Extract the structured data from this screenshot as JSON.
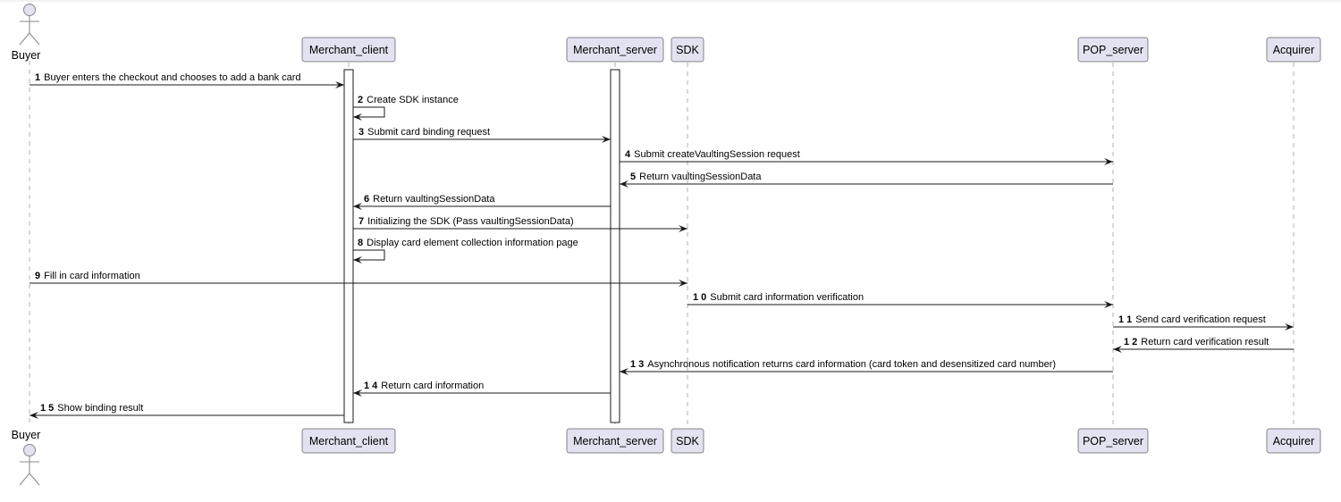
{
  "colors": {
    "participant_fill": "#e2e2f0",
    "participant_border": "#181818",
    "line": "#181818",
    "lifeline": "#b0b0b0"
  },
  "participants": [
    {
      "id": "buyer",
      "label": "Buyer",
      "kind": "actor"
    },
    {
      "id": "merchant_client",
      "label": "Merchant_client",
      "kind": "participant"
    },
    {
      "id": "merchant_server",
      "label": "Merchant_server",
      "kind": "participant"
    },
    {
      "id": "sdk",
      "label": "SDK",
      "kind": "participant"
    },
    {
      "id": "pop_server",
      "label": "POP_server",
      "kind": "participant"
    },
    {
      "id": "acquirer",
      "label": "Acquirer",
      "kind": "participant"
    }
  ],
  "messages": [
    {
      "num": "1",
      "from": "buyer",
      "to": "merchant_client",
      "text": "Buyer enters the checkout and chooses to add a bank card"
    },
    {
      "num": "2",
      "from": "merchant_client",
      "to": "merchant_client",
      "text": "Create SDK instance"
    },
    {
      "num": "3",
      "from": "merchant_client",
      "to": "merchant_server",
      "text": "Submit card binding request"
    },
    {
      "num": "4",
      "from": "merchant_server",
      "to": "pop_server",
      "text": "Submit createVaultingSession request"
    },
    {
      "num": "5",
      "from": "pop_server",
      "to": "merchant_server",
      "text": "Return vaultingSessionData"
    },
    {
      "num": "6",
      "from": "merchant_server",
      "to": "merchant_client",
      "text": "Return vaultingSessionData"
    },
    {
      "num": "7",
      "from": "merchant_client",
      "to": "sdk",
      "text": "Initializing the SDK (Pass vaultingSessionData)"
    },
    {
      "num": "8",
      "from": "merchant_client",
      "to": "merchant_client",
      "text": "Display card element collection information page"
    },
    {
      "num": "9",
      "from": "buyer",
      "to": "sdk",
      "text": "Fill in card information"
    },
    {
      "num": "1 0",
      "from": "sdk",
      "to": "pop_server",
      "text": "Submit card information verification"
    },
    {
      "num": "1 1",
      "from": "pop_server",
      "to": "acquirer",
      "text": "Send card verification request"
    },
    {
      "num": "1 2",
      "from": "acquirer",
      "to": "pop_server",
      "text": "Return card verification result"
    },
    {
      "num": "1 3",
      "from": "pop_server",
      "to": "merchant_server",
      "text": "Asynchronous notification returns card information (card token and desensitized card number)"
    },
    {
      "num": "1 4",
      "from": "merchant_server",
      "to": "merchant_client",
      "text": "Return card information"
    },
    {
      "num": "1 5",
      "from": "merchant_client",
      "to": "buyer",
      "text": "Show binding result"
    }
  ],
  "activations": [
    "merchant_client",
    "merchant_server"
  ]
}
